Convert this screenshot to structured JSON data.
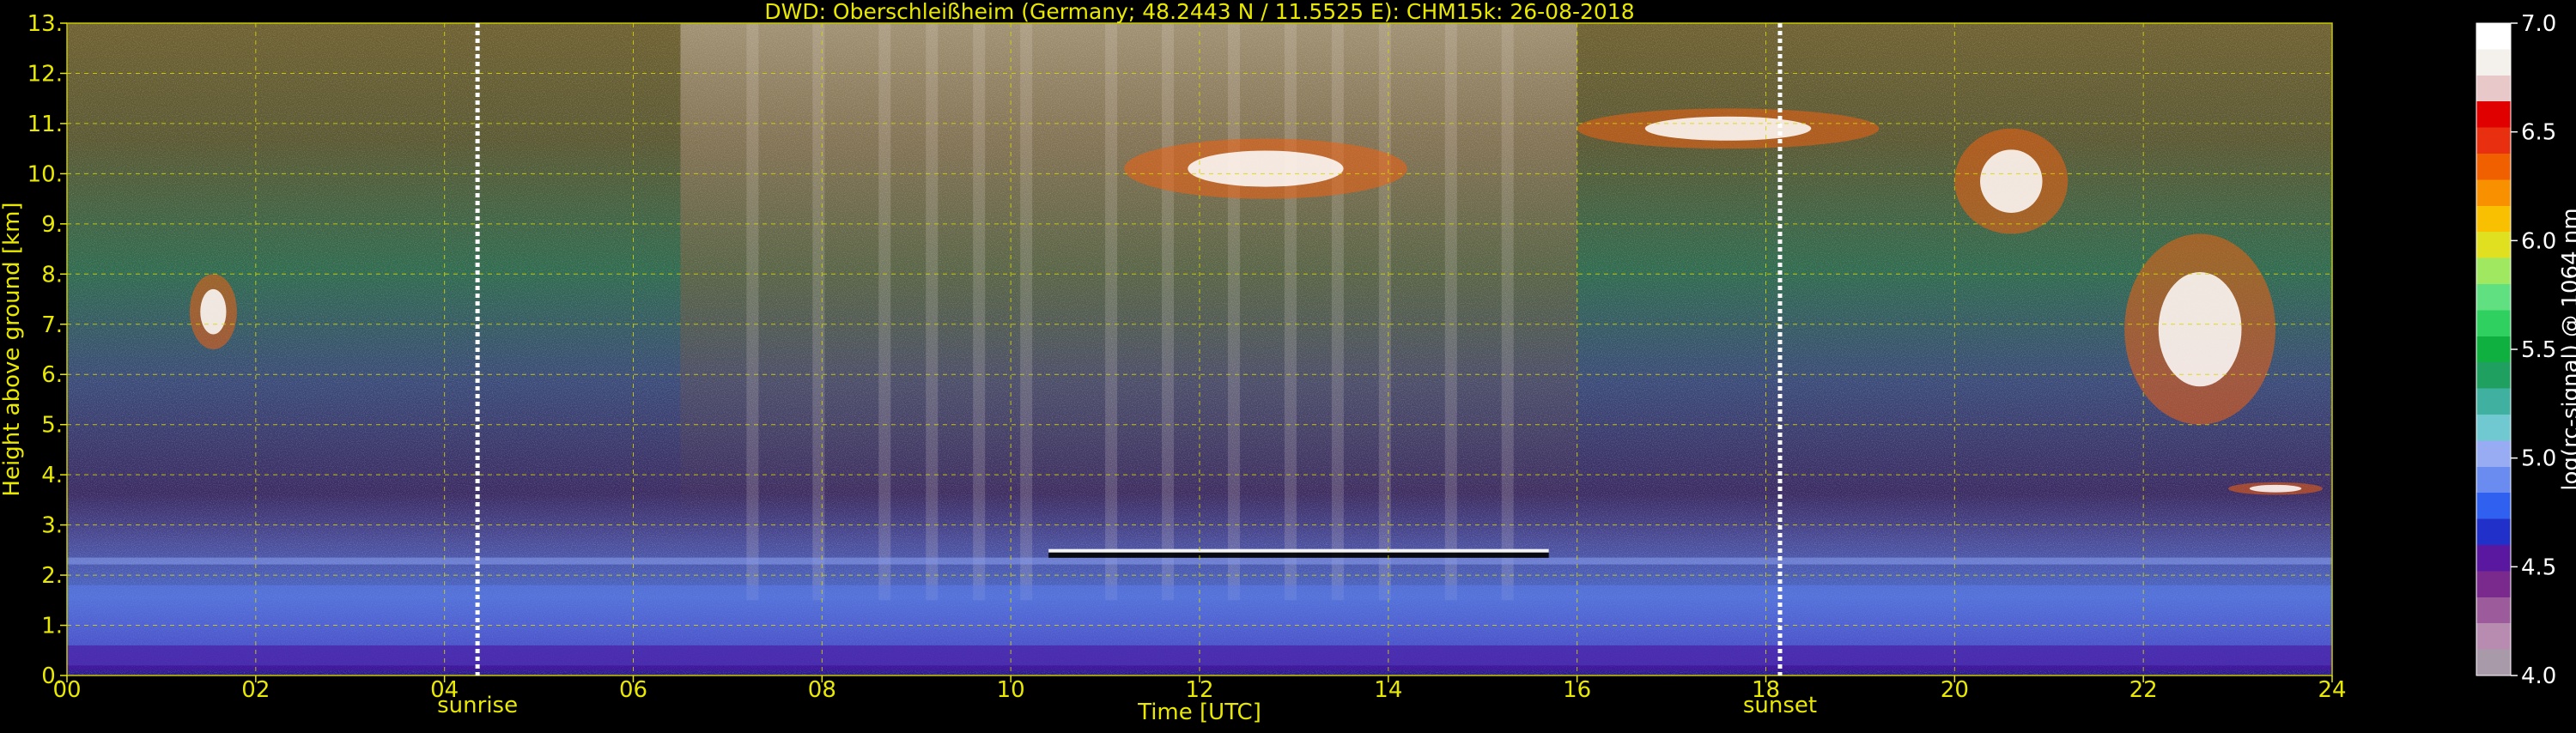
{
  "chart_data": {
    "type": "heatmap",
    "title": "DWD: Oberschleißheim (Germany; 48.2443 N / 11.5525 E):    CHM15k: 26-08-2018",
    "xlabel": "Time [UTC]",
    "ylabel": "Height above ground [km]",
    "x_ticks": [
      "00",
      "02",
      "04",
      "06",
      "08",
      "10",
      "12",
      "14",
      "16",
      "18",
      "20",
      "22",
      "24"
    ],
    "x_tick_values": [
      0,
      2,
      4,
      6,
      8,
      10,
      12,
      14,
      16,
      18,
      20,
      22,
      24
    ],
    "y_ticks": [
      "0.",
      "1.",
      "2.",
      "3.",
      "4.",
      "5.",
      "6.",
      "7.",
      "8.",
      "9.",
      "10.",
      "11.",
      "12.",
      "13."
    ],
    "y_tick_values": [
      0,
      1,
      2,
      3,
      4,
      5,
      6,
      7,
      8,
      9,
      10,
      11,
      12,
      13
    ],
    "xlim": [
      0,
      24
    ],
    "ylim": [
      0,
      13
    ],
    "grid": true,
    "markers": [
      {
        "label": "sunrise",
        "time": 4.35
      },
      {
        "label": "sunset",
        "time": 18.15
      }
    ],
    "colorbar": {
      "label": "log(rc-signal) @ 1064 nm",
      "range": [
        4.0,
        7.0
      ],
      "ticks": [
        "4.0",
        "4.5",
        "5.0",
        "5.5",
        "6.0",
        "6.5",
        "7.0"
      ],
      "tick_values": [
        4.0,
        4.5,
        5.0,
        5.5,
        6.0,
        6.5,
        7.0
      ],
      "colors": [
        "#a89aa8",
        "#b88cb0",
        "#9c5c9c",
        "#7a2a8c",
        "#5a18a0",
        "#2030c8",
        "#3060f0",
        "#6a8cf0",
        "#98acf4",
        "#70c8d0",
        "#40b0a0",
        "#20a060",
        "#10b040",
        "#30d060",
        "#60e080",
        "#a0e860",
        "#e0e020",
        "#f8c000",
        "#f89000",
        "#f06000",
        "#e83010",
        "#e00000",
        "#e8c8c8",
        "#f4f0ec",
        "#ffffff"
      ]
    },
    "features": [
      {
        "name": "boundary layer top",
        "time_range": [
          0,
          24
        ],
        "height_km": 2.2
      },
      {
        "name": "residual aerosol layer",
        "time_range": [
          0,
          24
        ],
        "height_range_km": [
          0.2,
          1.8
        ]
      },
      {
        "name": "cloud layer",
        "time_range": [
          10.4,
          15.7
        ],
        "height_km": 2.4
      },
      {
        "name": "cloud",
        "time_range": [
          1.3,
          1.8
        ],
        "height_range_km": [
          6.5,
          8.0
        ]
      },
      {
        "name": "cloud",
        "time_range": [
          11.2,
          14.2
        ],
        "height_range_km": [
          9.5,
          10.7
        ]
      },
      {
        "name": "cloud",
        "time_range": [
          16.0,
          19.2
        ],
        "height_range_km": [
          10.5,
          11.3
        ]
      },
      {
        "name": "cloud",
        "time_range": [
          20.0,
          21.2
        ],
        "height_range_km": [
          8.8,
          10.9
        ]
      },
      {
        "name": "cloud",
        "time_range": [
          21.8,
          23.4
        ],
        "height_range_km": [
          5.0,
          8.8
        ]
      },
      {
        "name": "cloud",
        "time_range": [
          22.9,
          23.9
        ],
        "height_km": 3.7
      }
    ]
  }
}
